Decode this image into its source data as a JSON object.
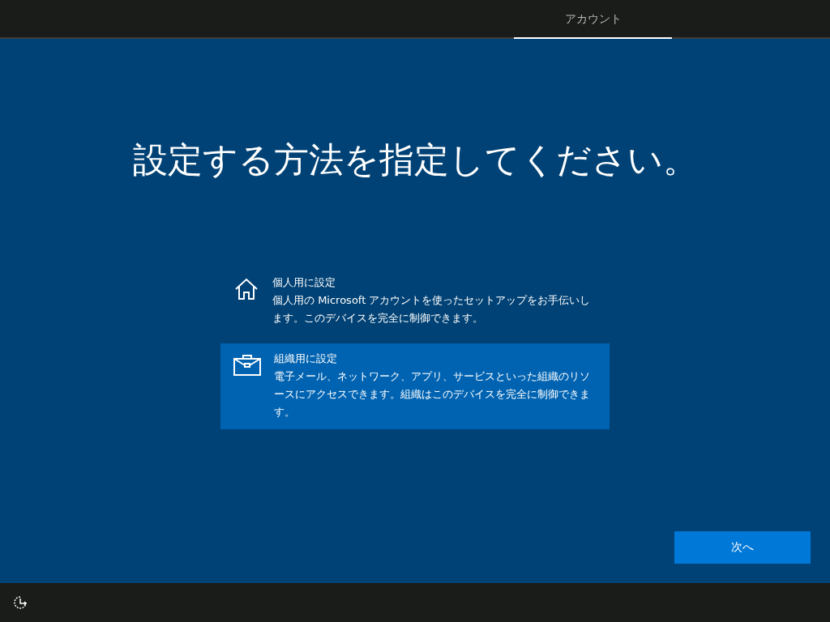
{
  "header": {
    "tabs": [
      {
        "label": "アカウント",
        "selected": true
      }
    ]
  },
  "title": "設定する方法を指定してください。",
  "options": [
    {
      "kind": "home",
      "title": "個人用に設定",
      "description": "個人用の Microsoft アカウントを使ったセットアップをお手伝いします。このデバイスを完全に制御できます。",
      "selected": false
    },
    {
      "kind": "work",
      "title": "組織用に設定",
      "description": "電子メール、ネットワーク、アプリ、サービスといった組織のリソースにアクセスできます。組織はこのデバイスを完全に制御できます。",
      "selected": true
    }
  ],
  "next_button": "次へ"
}
